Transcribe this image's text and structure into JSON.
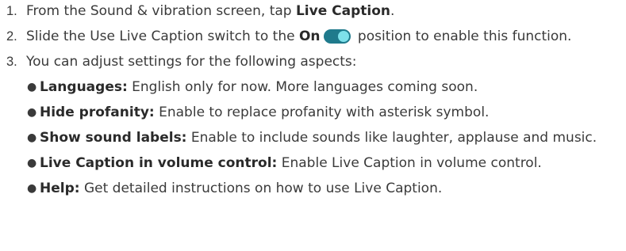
{
  "steps": [
    {
      "num": "1.",
      "pre": "From the Sound & vibration screen, tap ",
      "bold": "Live Caption",
      "post": "."
    },
    {
      "num": "2.",
      "pre": "Slide the Use Live Caption switch to the ",
      "bold": "On",
      "post": " position to enable this function.",
      "toggle_color": "#1f7a8c"
    },
    {
      "num": "3.",
      "text": "You can adjust settings for the following aspects:"
    }
  ],
  "options": [
    {
      "label": "Languages:",
      "desc": " English only for now. More languages coming soon."
    },
    {
      "label": "Hide profanity:",
      "desc": " Enable to replace profanity with asterisk symbol."
    },
    {
      "label": "Show sound labels:",
      "desc": " Enable to include sounds like laughter, applause and music."
    },
    {
      "label": "Live Caption in volume control:",
      "desc": " Enable Live Caption in volume control."
    },
    {
      "label": "Help:",
      "desc": " Get detailed instructions on how to use Live Caption."
    }
  ],
  "bullet_char": "●"
}
